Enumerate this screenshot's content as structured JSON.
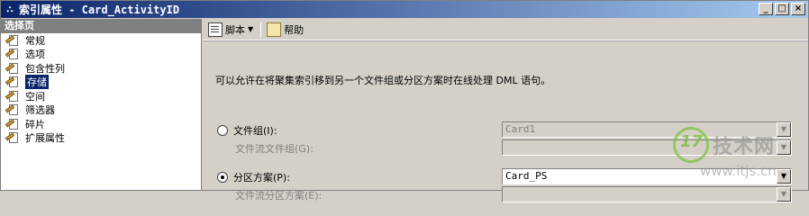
{
  "window": {
    "title": "索引属性 - Card_ActivityID",
    "buttons": {
      "minimize": "_",
      "maximize": "□",
      "close": "×"
    }
  },
  "sidebar": {
    "header": "选择页",
    "items": [
      {
        "label": "常规",
        "selected": false
      },
      {
        "label": "选项",
        "selected": false
      },
      {
        "label": "包含性列",
        "selected": false
      },
      {
        "label": "存储",
        "selected": true
      },
      {
        "label": "空间",
        "selected": false
      },
      {
        "label": "筛选器",
        "selected": false
      },
      {
        "label": "碎片",
        "selected": false
      },
      {
        "label": "扩展属性",
        "selected": false
      }
    ]
  },
  "toolbar": {
    "script_label": "脚本",
    "help_label": "帮助"
  },
  "main": {
    "description": "可以允许在将聚集索引移到另一个文件组或分区方案时在线处理 DML 语句。",
    "filegroup": {
      "label": "文件组(I):",
      "selected": false,
      "value": "Card1",
      "filestream_label": "文件流文件组(G):",
      "filestream_value": ""
    },
    "partition": {
      "label": "分区方案(P):",
      "selected": true,
      "value": "Card_PS",
      "filestream_label": "文件流分区方案(E):",
      "filestream_value": ""
    }
  },
  "watermark": {
    "number": "17",
    "title": "技术网",
    "url": "www.itjs.cn"
  }
}
